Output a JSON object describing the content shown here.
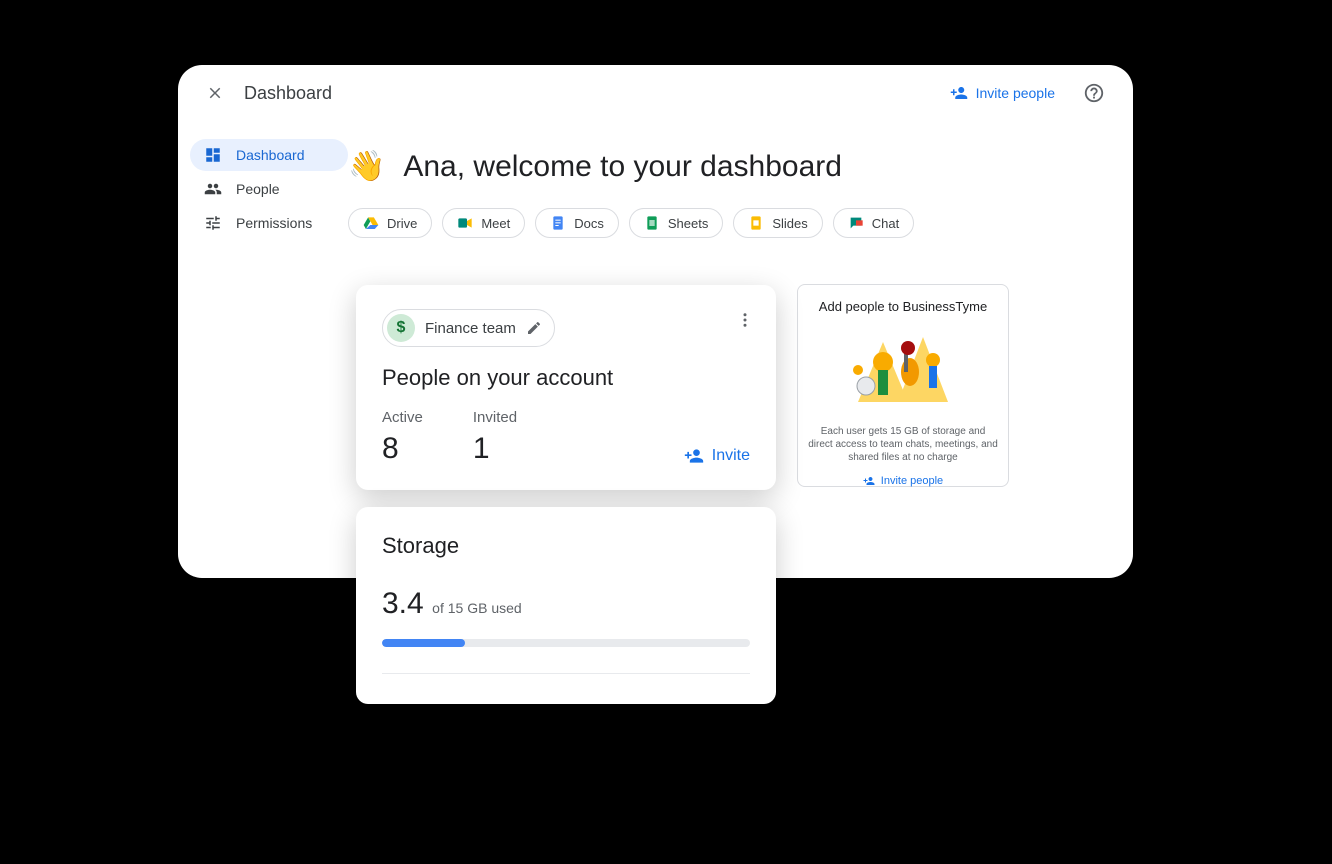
{
  "header": {
    "title": "Dashboard",
    "invite_label": "Invite people"
  },
  "sidebar": {
    "items": [
      {
        "label": "Dashboard",
        "active": true
      },
      {
        "label": "People",
        "active": false
      },
      {
        "label": "Permissions",
        "active": false
      }
    ]
  },
  "welcome": {
    "emoji": "👋",
    "text": "Ana, welcome to your dashboard"
  },
  "apps": [
    {
      "label": "Drive"
    },
    {
      "label": "Meet"
    },
    {
      "label": "Docs"
    },
    {
      "label": "Sheets"
    },
    {
      "label": "Slides"
    },
    {
      "label": "Chat"
    }
  ],
  "people_card": {
    "team_name": "Finance team",
    "title": "People on your account",
    "active_label": "Active",
    "active_count": "8",
    "invited_label": "Invited",
    "invited_count": "1",
    "invite_label": "Invite"
  },
  "storage_card": {
    "title": "Storage",
    "used_number": "3.4",
    "used_suffix": "of 15 GB used",
    "fill_percent": 22.6
  },
  "add_card": {
    "title": "Add people to BusinessTyme",
    "desc": "Each user gets 15 GB of storage and direct access to team chats, meetings, and shared files at no charge",
    "link_label": "Invite people"
  }
}
